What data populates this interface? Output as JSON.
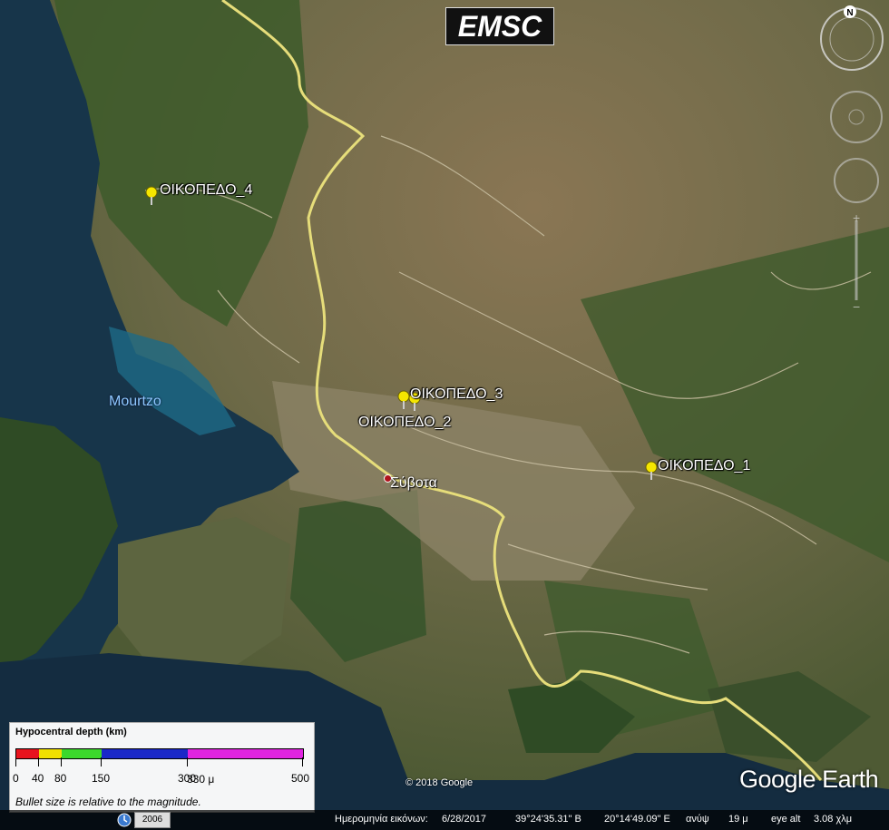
{
  "overlay": {
    "logo_text": "EMSC"
  },
  "placemarks": [
    {
      "name": "ΟΙΚΟΠΕΔΟ_4",
      "pin_color": "#f5e600"
    },
    {
      "name": "ΟΙΚΟΠΕΔΟ_3",
      "pin_color": "#f5e600"
    },
    {
      "name": "ΟΙΚΟΠΕΔΟ_2",
      "pin_color": "#f5e600"
    },
    {
      "name": "ΟΙΚΟΠΕΔΟ_1",
      "pin_color": "#f5e600"
    }
  ],
  "places": {
    "water_label": "Mourtzo",
    "town_label": "Σύβοτα"
  },
  "compass": {
    "north_label": "N"
  },
  "legend": {
    "title": "Hypocentral depth (km)",
    "segments": [
      {
        "color": "#e8141e"
      },
      {
        "color": "#f0e000"
      },
      {
        "color": "#3cd82c"
      },
      {
        "color": "#1a28c8"
      },
      {
        "color": "#e024e0"
      }
    ],
    "ticks": [
      "0",
      "40",
      "80",
      "150",
      "300",
      "500"
    ],
    "note": "Bullet size is relative to the magnitude.",
    "scale_text": "330 μ"
  },
  "attribution": {
    "copyright": "© 2018 Google",
    "logo": "Google Earth"
  },
  "status_bar": {
    "year": "2006",
    "image_date_label": "Ημερομηνία εικόνων:",
    "image_date": "6/28/2017",
    "latitude": "39°24'35.31\" Β",
    "longitude": "20°14'49.09\" Ε",
    "elevation_label": "ανύψ",
    "elevation": "19 μ",
    "eye_alt_label": "eye alt",
    "eye_alt": "3.08 χλμ"
  }
}
